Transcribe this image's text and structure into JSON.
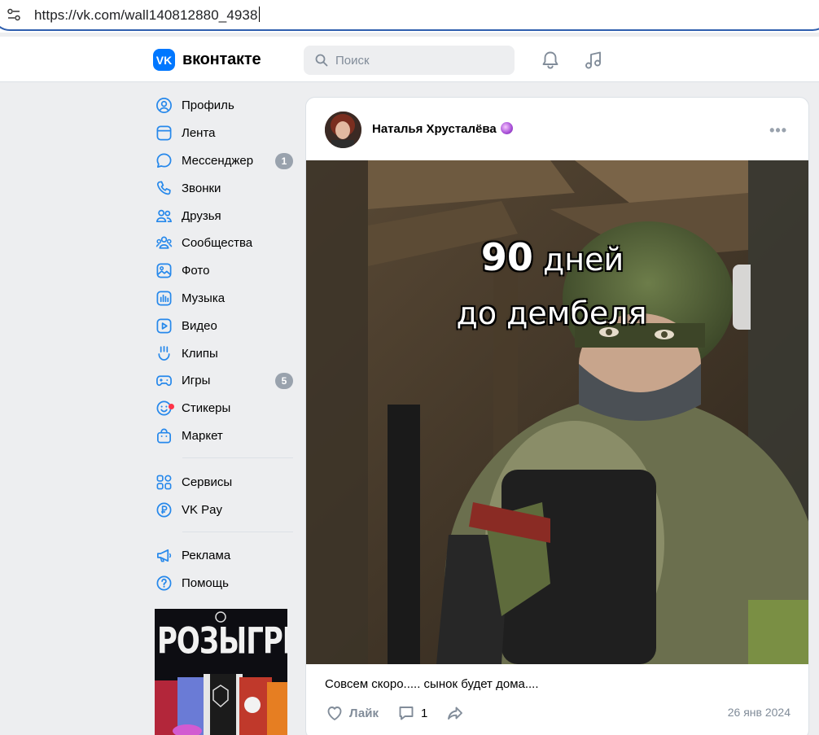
{
  "browser": {
    "url": "https://vk.com/wall140812880_4938"
  },
  "header": {
    "logo_text": "вконтакте",
    "logo_mark": "VK",
    "search_placeholder": "Поиск",
    "icons": [
      "search-icon",
      "bell-icon",
      "music-note-icon"
    ]
  },
  "nav": {
    "items": [
      {
        "label": "Профиль",
        "icon": "profile-icon"
      },
      {
        "label": "Лента",
        "icon": "news-feed-icon"
      },
      {
        "label": "Мессенджер",
        "icon": "chat-bubble-icon",
        "badge": "1"
      },
      {
        "label": "Звонки",
        "icon": "phone-icon"
      },
      {
        "label": "Друзья",
        "icon": "friends-icon"
      },
      {
        "label": "Сообщества",
        "icon": "communities-icon"
      },
      {
        "label": "Фото",
        "icon": "photo-icon"
      },
      {
        "label": "Музыка",
        "icon": "music-icon"
      },
      {
        "label": "Видео",
        "icon": "video-icon"
      },
      {
        "label": "Клипы",
        "icon": "clips-icon"
      },
      {
        "label": "Игры",
        "icon": "gamepad-icon",
        "badge": "5"
      },
      {
        "label": "Стикеры",
        "icon": "smile-icon"
      },
      {
        "label": "Маркет",
        "icon": "bag-icon"
      }
    ],
    "group2": [
      {
        "label": "Сервисы",
        "icon": "services-icon"
      },
      {
        "label": "VK Pay",
        "icon": "vkpay-icon"
      }
    ],
    "group3": [
      {
        "label": "Реклама",
        "icon": "megaphone-icon"
      },
      {
        "label": "Помощь",
        "icon": "help-icon"
      }
    ]
  },
  "promo": {
    "title": "РОЗЫГРЫШ"
  },
  "post": {
    "author": "Наталья Хрусталёва",
    "photo_caption_num": "90",
    "photo_caption_line1": "дней",
    "photo_caption_line2": "до дембеля",
    "text": "Совсем скоро..... сынок будет дома....",
    "like_label": "Лайк",
    "comments_count": "1",
    "date": "26 янв 2024"
  },
  "colors": {
    "accent": "#0077ff",
    "icon": "#2688eb",
    "secondary_text": "#818c99",
    "page_bg": "#edeef0",
    "badge_bg": "#99a2ad",
    "dot_red": "#ff3347"
  }
}
